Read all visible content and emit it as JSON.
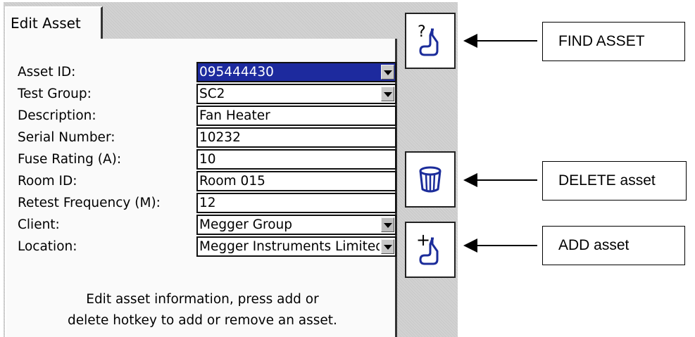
{
  "tab": {
    "label": "Edit Asset"
  },
  "form": {
    "fields": [
      {
        "label": "Asset ID:",
        "value": "095444430",
        "type": "dropdown",
        "selected": true
      },
      {
        "label": "Test Group:",
        "value": "SC2",
        "type": "dropdown"
      },
      {
        "label": "Description:",
        "value": "Fan Heater",
        "type": "text"
      },
      {
        "label": "Serial Number:",
        "value": "10232",
        "type": "text"
      },
      {
        "label": "Fuse Rating (A):",
        "value": "10",
        "type": "text"
      },
      {
        "label": "Room ID:",
        "value": "Room 015",
        "type": "text"
      },
      {
        "label": "Retest Frequency (M):",
        "value": "12",
        "type": "text"
      },
      {
        "label": "Client:",
        "value": "Megger Group",
        "type": "dropdown",
        "disabled": true
      },
      {
        "label": "Location:",
        "value": "Megger Instruments Limited",
        "type": "dropdown"
      }
    ],
    "hint_line1": "Edit asset information, press add or",
    "hint_line2": "delete hotkey to add or remove an asset."
  },
  "hotkeys": {
    "find": {
      "icon": "find-asset-icon",
      "symbol": "?"
    },
    "delete": {
      "icon": "trash-icon"
    },
    "add": {
      "icon": "add-asset-icon",
      "symbol": "+"
    }
  },
  "callouts": {
    "find": "FIND ASSET",
    "delete": "DELETE asset",
    "add": "ADD asset"
  },
  "colors": {
    "selection": "#1d2a9e",
    "screen_bg": "#d2d2d2",
    "panel_bg": "#fafafa"
  }
}
